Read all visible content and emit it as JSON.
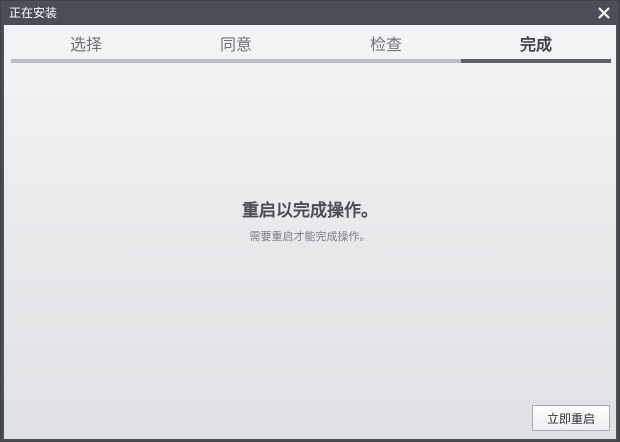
{
  "window": {
    "title": "正在安装"
  },
  "icons": {
    "close": "close-icon"
  },
  "tabs": [
    {
      "label": "选择",
      "active": false
    },
    {
      "label": "同意",
      "active": false
    },
    {
      "label": "检查",
      "active": false
    },
    {
      "label": "完成",
      "active": true
    }
  ],
  "main": {
    "heading": "重启以完成操作。",
    "subtext": "需要重启才能完成操作。"
  },
  "actions": {
    "restart_label": "立即重启"
  },
  "colors": {
    "titlebar": "#4a4f57",
    "tab_active_bar": "#5c6168",
    "tab_inactive_bar": "#b9bcc0"
  }
}
